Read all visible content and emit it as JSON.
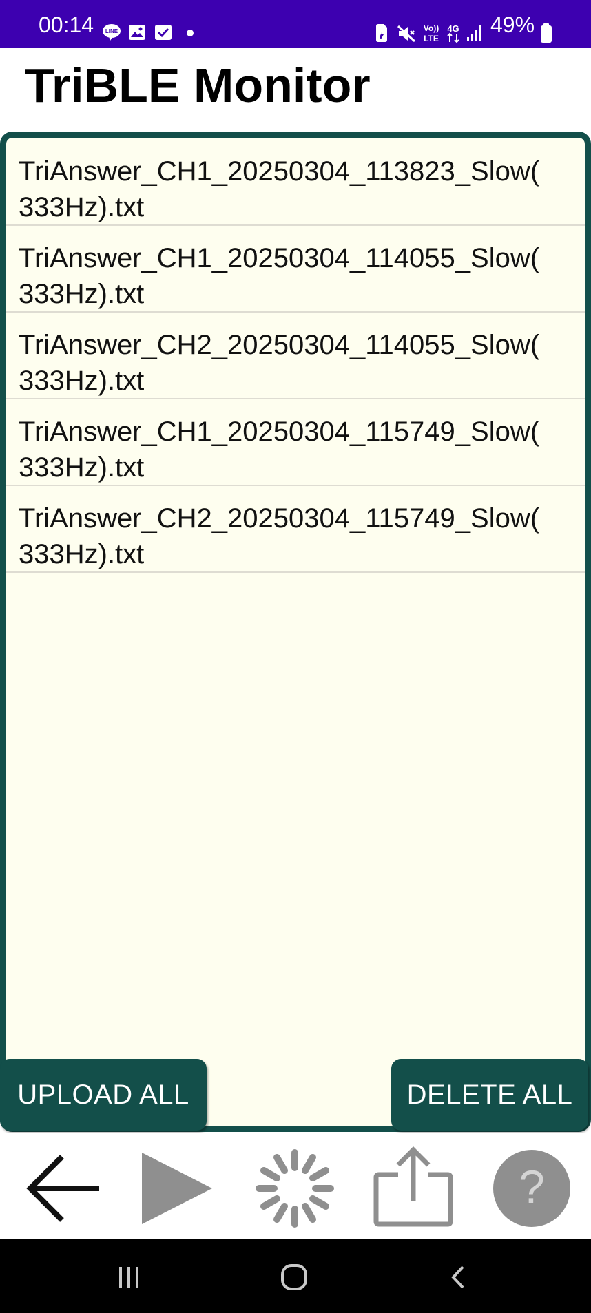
{
  "status_bar": {
    "time": "00:14",
    "battery": "49%",
    "left_icons": [
      "line-icon",
      "gallery-icon",
      "checkbox-icon",
      "dot-icon"
    ],
    "right_icons": [
      "sim-icon",
      "mute-icon",
      "volte-icon",
      "4g-icon",
      "signal-icon",
      "battery-icon"
    ],
    "volte_label": "Vo)) LTE",
    "network_label": "4G"
  },
  "app": {
    "title": "TriBLE Monitor"
  },
  "files": [
    {
      "line1": "TriAnswer_CH1_20250304_113823_Slow(",
      "line2": "333Hz).txt"
    },
    {
      "line1": "TriAnswer_CH1_20250304_114055_Slow(",
      "line2": "333Hz).txt"
    },
    {
      "line1": "TriAnswer_CH2_20250304_114055_Slow(",
      "line2": "333Hz).txt"
    },
    {
      "line1": "TriAnswer_CH1_20250304_115749_Slow(",
      "line2": "333Hz).txt"
    },
    {
      "line1": "TriAnswer_CH2_20250304_115749_Slow(",
      "line2": "333Hz).txt"
    }
  ],
  "actions": {
    "upload_all": "UPLOAD ALL",
    "delete_all": "DELETE ALL"
  },
  "toolbar": {
    "icons": [
      "back-arrow-icon",
      "play-icon",
      "loading-spinner-icon",
      "share-icon",
      "help-icon"
    ],
    "help_glyph": "?"
  },
  "system_nav": {
    "icons": [
      "recents-icon",
      "home-icon",
      "back-icon"
    ]
  },
  "colors": {
    "status_bar": "#3d00b0",
    "accent": "#134f4a",
    "panel_bg": "#fefeef",
    "inactive_icon": "#8f8f8f"
  }
}
